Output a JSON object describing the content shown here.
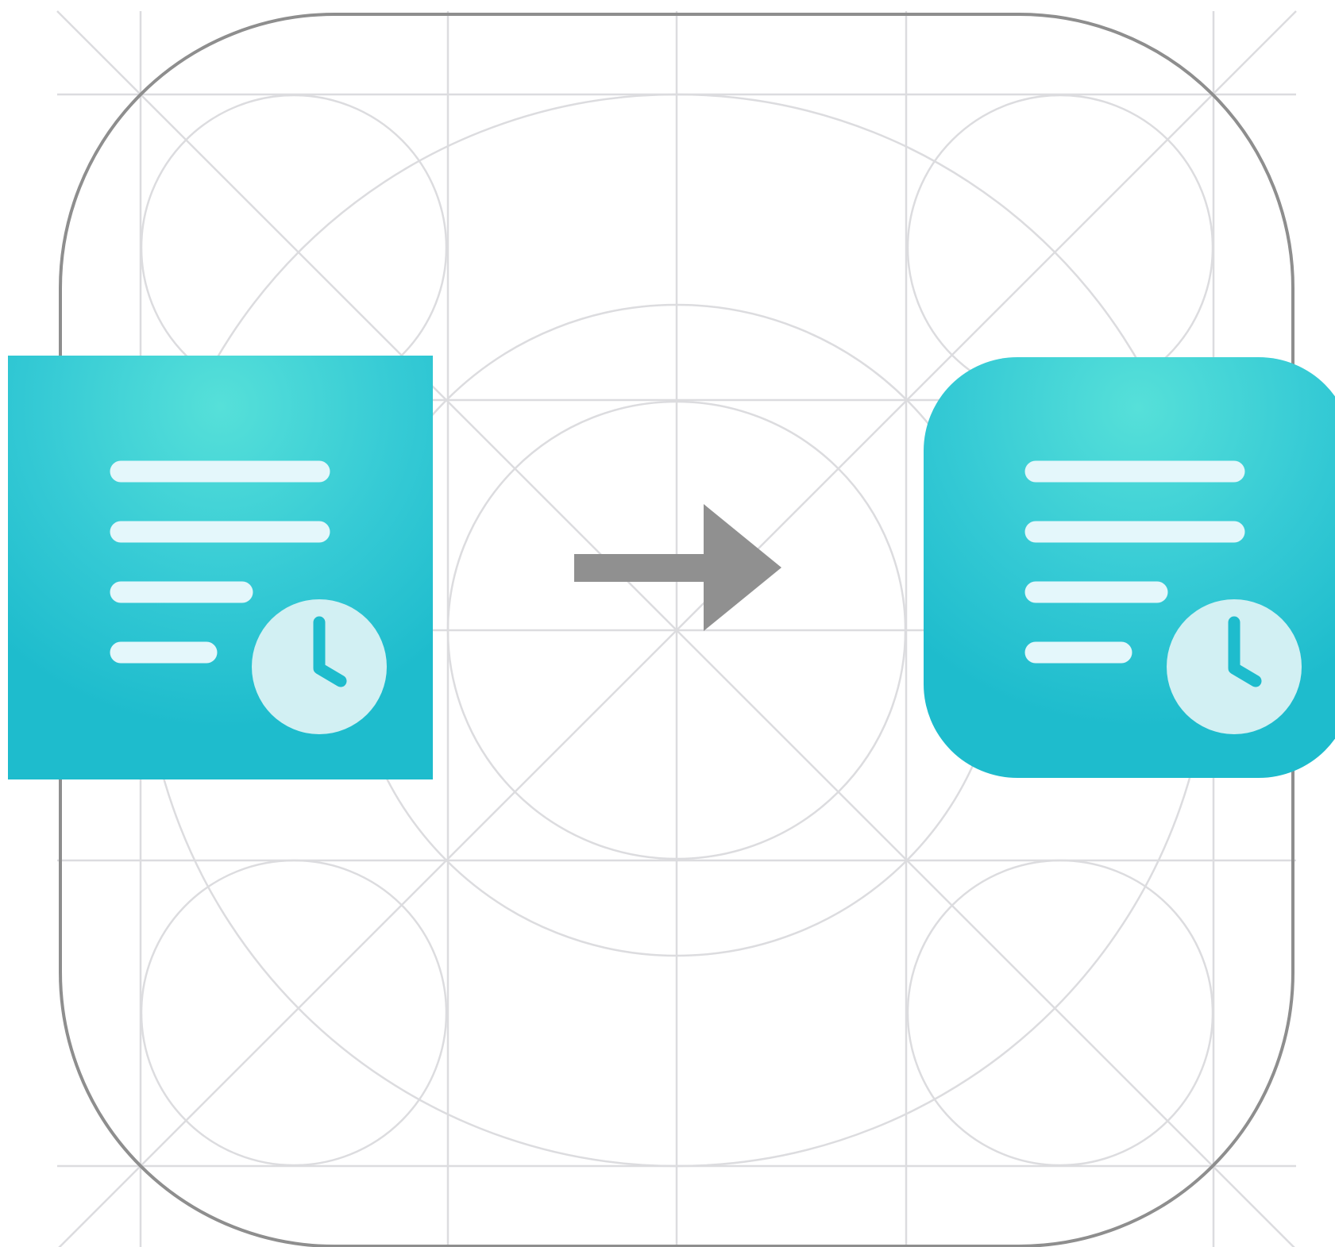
{
  "diagram": {
    "colors": {
      "grid": "#dcdcdf",
      "outline": "#8e8e8e",
      "arrow": "#909090",
      "icon_gradient_light": "#56e0d9",
      "icon_gradient_dark": "#1ebccd",
      "icon_lines": "#e4f7fb",
      "clock_face": "#d2f0f3",
      "clock_hands": "#1ebccd"
    },
    "template": {
      "name": "app-icon-grid-template"
    },
    "source_icon": {
      "shape": "square",
      "icon": "document-clock-icon"
    },
    "transform_arrow": {
      "icon": "right-arrow-icon"
    },
    "result_icon": {
      "shape": "rounded-square",
      "icon": "document-clock-icon"
    }
  }
}
